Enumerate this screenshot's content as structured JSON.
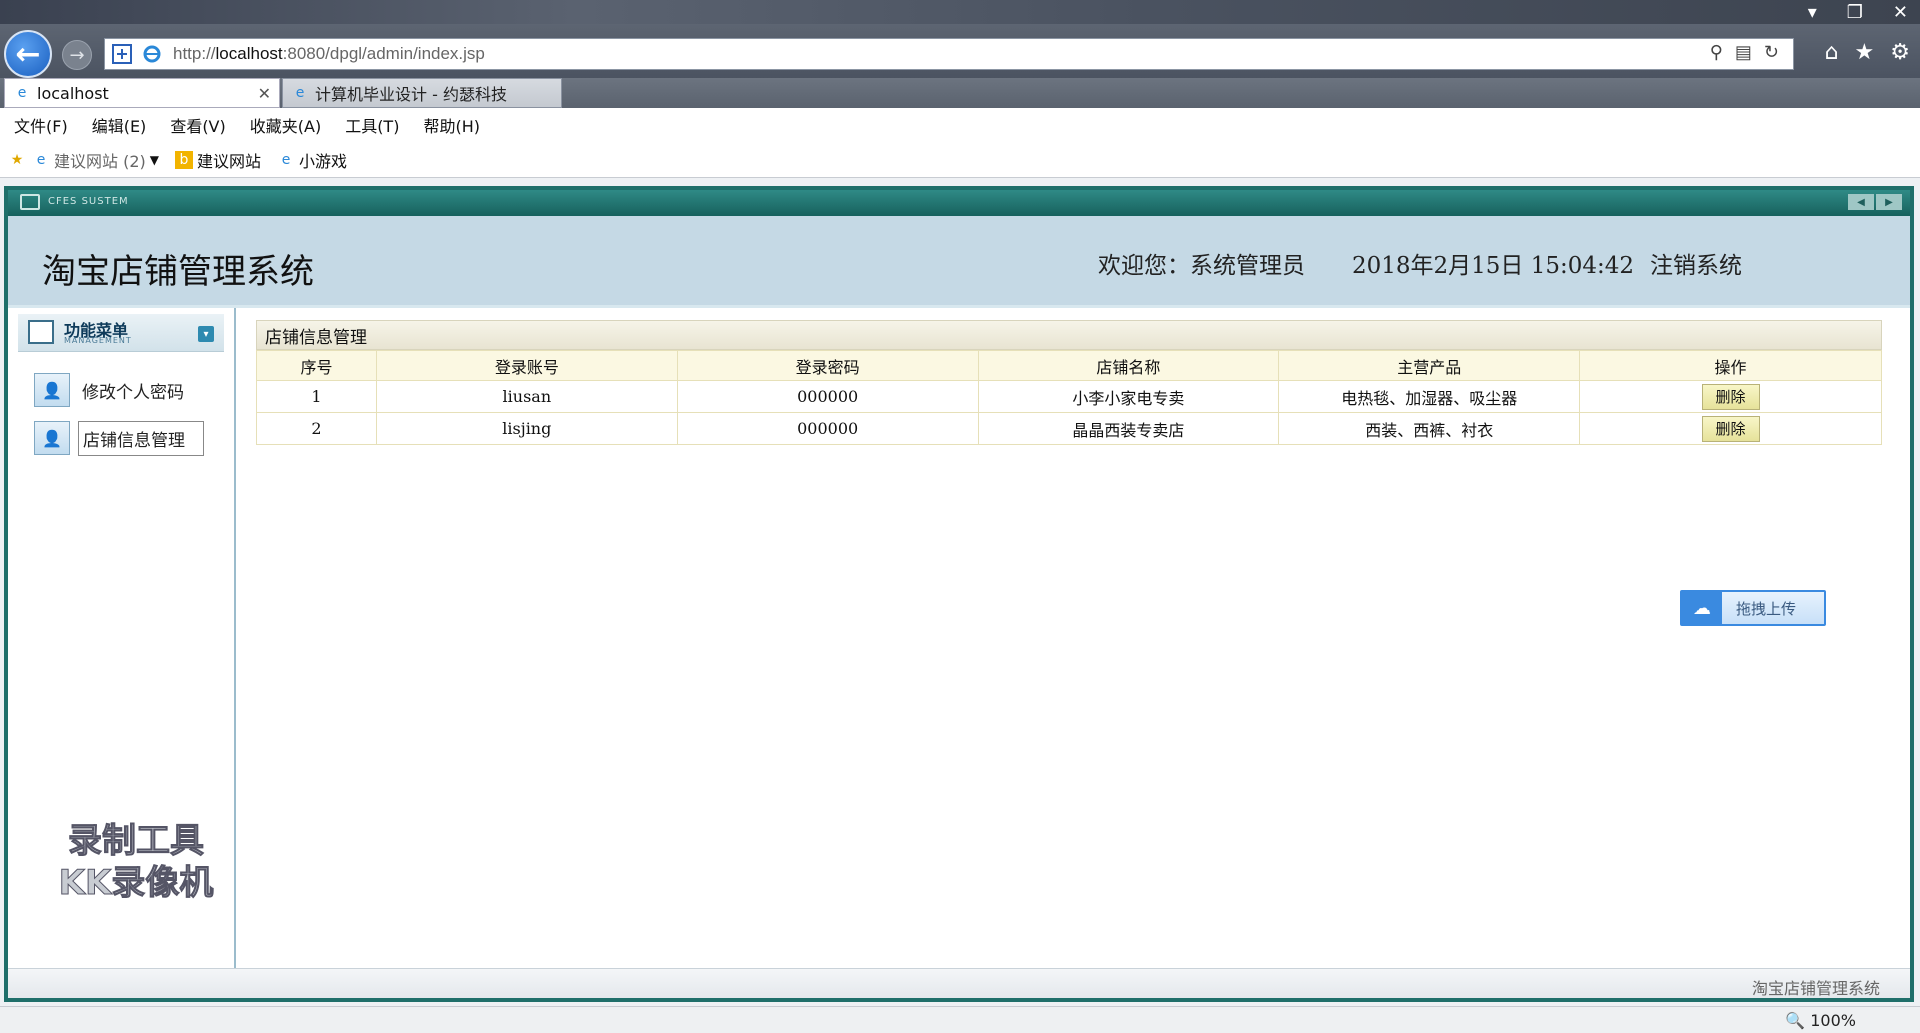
{
  "browser": {
    "url_prefix": "http://",
    "url_host": "localhost",
    "url_rest": ":8080/dpgl/admin/index.jsp",
    "tabs": [
      {
        "label": "localhost"
      },
      {
        "label": "计算机毕业设计 - 约瑟科技"
      }
    ],
    "menu": [
      "文件(F)",
      "编辑(E)",
      "查看(V)",
      "收藏夹(A)",
      "工具(T)",
      "帮助(H)"
    ],
    "favorites": [
      "建议网站 (2)",
      "建议网站",
      "小游戏"
    ],
    "zoom": "100%"
  },
  "app": {
    "system_label": "CFES SUSTEM",
    "title": "淘宝店铺管理系统",
    "welcome": "欢迎您：系统管理员",
    "datetime": "2018年2月15日 15:04:42",
    "logout": "注销系统",
    "footer": "淘宝店铺管理系统"
  },
  "sidebar": {
    "title": "功能菜单",
    "subtitle": "MANAGEMENT",
    "items": [
      {
        "label": "修改个人密码"
      },
      {
        "label": "店铺信息管理"
      }
    ]
  },
  "panel": {
    "title": "店铺信息管理",
    "columns": [
      "序号",
      "登录账号",
      "登录密码",
      "店铺名称",
      "主营产品",
      "操作"
    ],
    "rows": [
      {
        "no": "1",
        "account": "liusan",
        "password": "000000",
        "shop": "小李小家电专卖",
        "products": "电热毯、加湿器、吸尘器",
        "action": "删除"
      },
      {
        "no": "2",
        "account": "lisjing",
        "password": "000000",
        "shop": "晶晶西装专卖店",
        "products": "西装、西裤、衬衣",
        "action": "删除"
      }
    ]
  },
  "upload": {
    "label": "拖拽上传"
  },
  "watermark": [
    "录制工具",
    "KK录像机"
  ]
}
